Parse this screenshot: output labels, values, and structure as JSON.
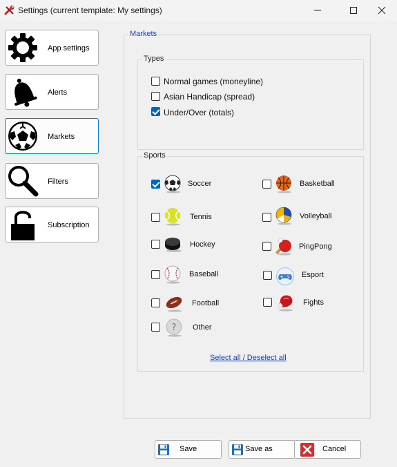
{
  "window": {
    "title": "Settings (current template: My settings)",
    "icon": "wrench-icon"
  },
  "nav": {
    "items": [
      {
        "label": "App settings",
        "icon": "gear-icon",
        "active": false
      },
      {
        "label": "Alerts",
        "icon": "bell-icon",
        "active": false
      },
      {
        "label": "Markets",
        "icon": "soccer-ball-icon",
        "active": true
      },
      {
        "label": "Filters",
        "icon": "magnifier-icon",
        "active": false
      },
      {
        "label": "Subscription",
        "icon": "padlock-icon",
        "active": false
      }
    ]
  },
  "markets": {
    "legend": "Markets",
    "types": {
      "legend": "Types",
      "options": [
        {
          "label": "Normal games (moneyline)",
          "checked": false
        },
        {
          "label": "Asian Handicap (spread)",
          "checked": false
        },
        {
          "label": "Under/Over (totals)",
          "checked": true
        }
      ]
    },
    "sports": {
      "legend": "Sports",
      "items": [
        {
          "label": "Soccer",
          "checked": true,
          "icon": "soccer-ball-icon"
        },
        {
          "label": "Basketball",
          "checked": false,
          "icon": "basketball-icon"
        },
        {
          "label": "Tennis",
          "checked": false,
          "icon": "tennis-ball-icon"
        },
        {
          "label": "Volleyball",
          "checked": false,
          "icon": "volleyball-icon"
        },
        {
          "label": "Hockey",
          "checked": false,
          "icon": "hockey-puck-icon"
        },
        {
          "label": "PingPong",
          "checked": false,
          "icon": "ping-pong-paddle-icon"
        },
        {
          "label": "Baseball",
          "checked": false,
          "icon": "baseball-icon"
        },
        {
          "label": "Esport",
          "checked": false,
          "icon": "gamepad-icon"
        },
        {
          "label": "Football",
          "checked": false,
          "icon": "american-football-icon"
        },
        {
          "label": "Fights",
          "checked": false,
          "icon": "boxing-glove-icon"
        },
        {
          "label": "Other",
          "checked": false,
          "icon": "question-ball-icon"
        }
      ],
      "select_all": "Select all / Deselect all"
    }
  },
  "actions": {
    "save": "Save",
    "save_as": "Save as",
    "cancel": "Cancel"
  },
  "colors": {
    "accent": "#0067c0",
    "link": "#1a3cc8",
    "cancel_red": "#d32f2f"
  }
}
